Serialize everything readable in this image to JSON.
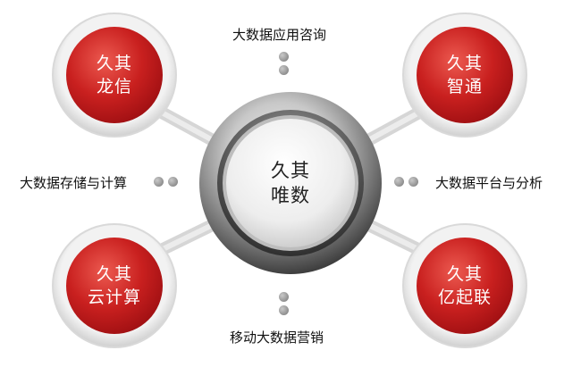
{
  "center": {
    "line1": "久其",
    "line2": "唯数"
  },
  "nodes": {
    "top_left": {
      "line1": "久其",
      "line2": "龙信"
    },
    "top_right": {
      "line1": "久其",
      "line2": "智通"
    },
    "bottom_left": {
      "line1": "久其",
      "line2": "云计算"
    },
    "bottom_right": {
      "line1": "久其",
      "line2": "亿起联"
    }
  },
  "labels": {
    "top": "大数据应用咨询",
    "left": "大数据存储与计算",
    "right": "大数据平台与分析",
    "bottom": "移动大数据营销"
  },
  "colors": {
    "node_red": "#c4161c",
    "node_red_light": "#e2473f",
    "ring_gray": "#dadada",
    "connector_gray": "#d4d4d4",
    "dot_gray": "#9a9a9a"
  }
}
